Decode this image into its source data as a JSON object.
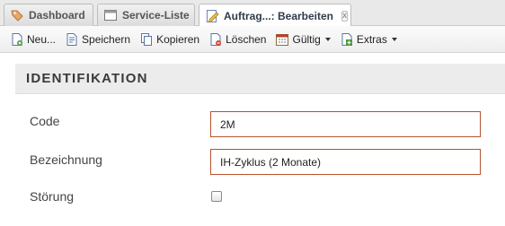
{
  "tabs": [
    {
      "label": "Dashboard",
      "icon": "tag-icon"
    },
    {
      "label": "Service-Liste",
      "icon": "window-icon"
    },
    {
      "label": "Auftrag...: Bearbeiten",
      "icon": "edit-form-icon",
      "close": "x"
    }
  ],
  "toolbar": {
    "new_label": "Neu...",
    "save_label": "Speichern",
    "copy_label": "Kopieren",
    "delete_label": "Löschen",
    "valid_label": "Gültig",
    "extras_label": "Extras"
  },
  "section": {
    "title": "IDENTIFIKATION",
    "code_label": "Code",
    "code_value": "2M",
    "name_label": "Bezeichnung",
    "name_value": "IH-Zyklus (2 Monate)",
    "fault_label": "Störung",
    "fault_checked": false
  },
  "colors": {
    "field_border": "#b5522f",
    "section_bg": "#ececec"
  }
}
